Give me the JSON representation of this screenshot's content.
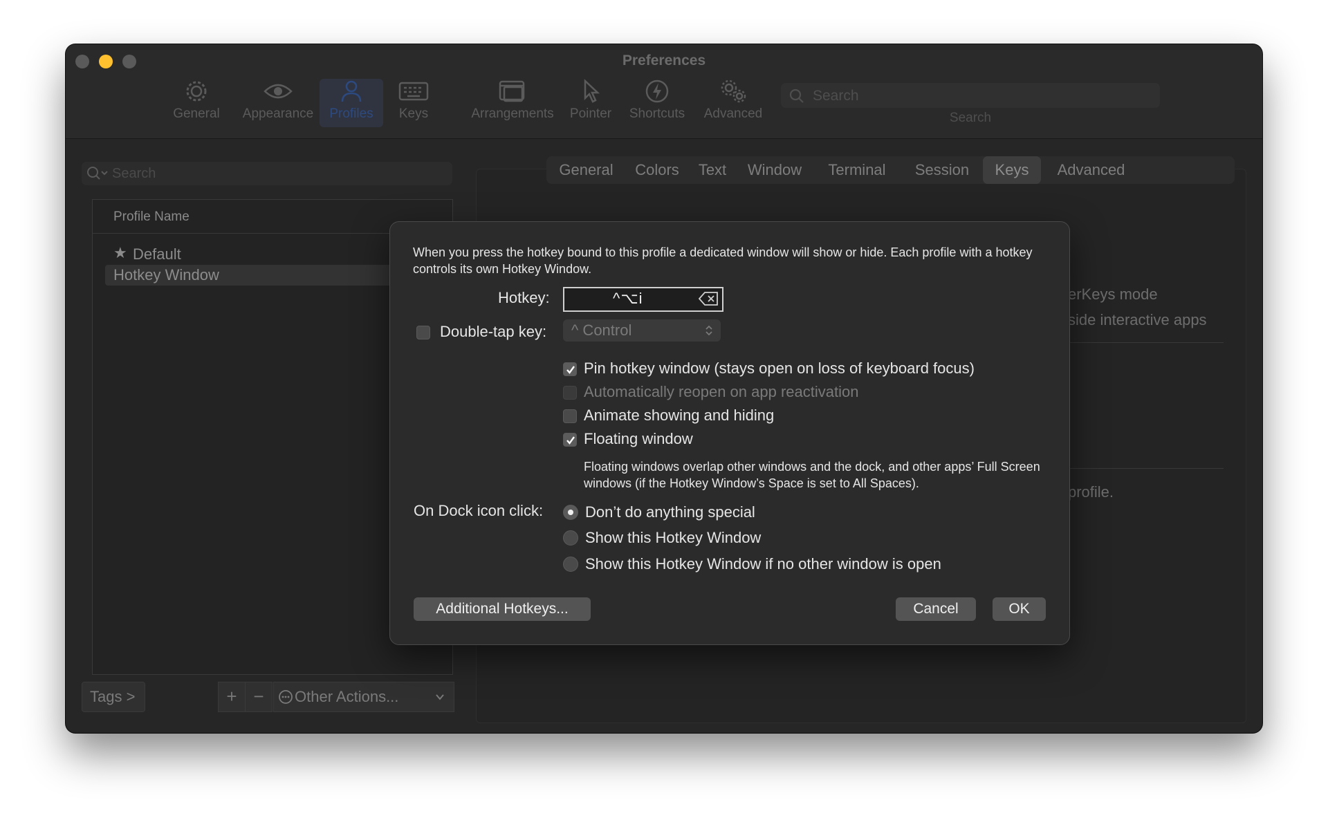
{
  "window": {
    "title": "Preferences",
    "traffic_colors": [
      "#5a5a5a",
      "#fec02f",
      "#5a5a5a"
    ]
  },
  "toolbar": {
    "items": [
      {
        "label": "General",
        "icon": "gear-icon"
      },
      {
        "label": "Appearance",
        "icon": "eye-icon"
      },
      {
        "label": "Profiles",
        "icon": "person-icon",
        "selected": true
      },
      {
        "label": "Keys",
        "icon": "keyboard-icon"
      },
      {
        "label": "Arrangements",
        "icon": "windows-icon"
      },
      {
        "label": "Pointer",
        "icon": "pointer-icon"
      },
      {
        "label": "Shortcuts",
        "icon": "bolt-icon"
      },
      {
        "label": "Advanced",
        "icon": "gears-icon"
      }
    ],
    "search_placeholder": "Search",
    "search_caption": "Search"
  },
  "profiles": {
    "search_placeholder": "Search",
    "column_header": "Profile Name",
    "rows": [
      {
        "name": "Default",
        "star": true
      },
      {
        "name": "Hotkey Window",
        "selected": true
      }
    ],
    "tags_label": "Tags >",
    "add_label": "+",
    "remove_label": "−",
    "other_actions_label": "Other Actions..."
  },
  "tabs": {
    "items": [
      "General",
      "Colors",
      "Text",
      "Window",
      "Terminal",
      "Session",
      "Keys",
      "Advanced"
    ],
    "selected": "Keys"
  },
  "background_text": {
    "line1": "erKeys mode",
    "line2": "side interactive apps",
    "line3": "profile."
  },
  "dialog": {
    "description": "When you press the hotkey bound to this profile a dedicated window will show or hide. Each profile with a hotkey controls its own Hotkey Window.",
    "hotkey_label": "Hotkey:",
    "hotkey_value": "^⌥i",
    "double_tap_label": "Double-tap key:",
    "double_tap_checked": false,
    "double_tap_value": "^ Control",
    "options": [
      {
        "label": "Pin hotkey window (stays open on loss of keyboard focus)",
        "checked": true,
        "disabled": false
      },
      {
        "label": "Automatically reopen on app reactivation",
        "checked": false,
        "disabled": true
      },
      {
        "label": "Animate showing and hiding",
        "checked": false,
        "disabled": false
      },
      {
        "label": "Floating window",
        "checked": true,
        "disabled": false
      }
    ],
    "floating_description": "Floating windows overlap other windows and the dock, and other apps’ Full Screen windows (if the Hotkey Window’s Space is set to All Spaces).",
    "dock_click_label": "On Dock icon click:",
    "dock_options": [
      {
        "label": "Don’t do anything special",
        "selected": true
      },
      {
        "label": "Show this Hotkey Window",
        "selected": false
      },
      {
        "label": "Show this Hotkey Window if no other window is open",
        "selected": false
      }
    ],
    "additional_hotkeys_label": "Additional Hotkeys...",
    "cancel_label": "Cancel",
    "ok_label": "OK"
  }
}
